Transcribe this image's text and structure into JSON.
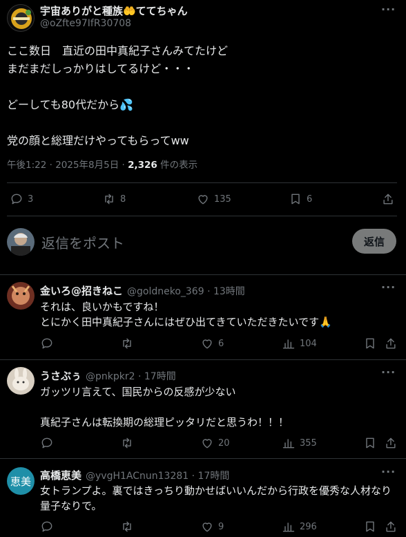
{
  "main_post": {
    "display_name": "宇宙ありがと種族🤲ててちゃん",
    "handle": "@oZfte97IfR30708",
    "lines": [
      "ここ数日　直近の田中真紀子さんみてたけど",
      "まだまだしっかりはしてるけど・・・",
      "",
      "どーしても80代だから💦",
      "",
      "党の顔と総理だけやってもらってww"
    ],
    "timestamp": "午後1:22 · 2025年8月5日 · ",
    "views_count": "2,326",
    "views_label": " 件の表示",
    "stats": {
      "replies": "3",
      "reposts": "8",
      "likes": "135",
      "bookmarks": "6"
    }
  },
  "reply_box": {
    "placeholder": "返信をポスト",
    "button_label": "返信"
  },
  "replies": [
    {
      "display_name": "金いろ@招きねこ",
      "handle": "@goldneko_369 · 13時間",
      "text": "それは、良いかもですね！\nとにかく田中真紀子さんにはぜひ出てきていただきたいです🙏",
      "likes": "6",
      "views": "104",
      "avatar_color": "#b5694a"
    },
    {
      "display_name": "うさぶぅ",
      "handle": "@pnkpkr2 · 17時間",
      "text": "ガッツリ言えて、国民からの反感が少ない\n\n真紀子さんは転換期の総理ピッタリだと思うわ！！！",
      "likes": "20",
      "views": "355",
      "avatar_color": "#c9b9a6"
    },
    {
      "display_name": "高橋恵美",
      "handle": "@yvgH1ACnun13281 · 17時間",
      "text": "女トランプよ。裏ではきっちり動かせばいいんだから行政を優秀な人材なり\n量子なりで。",
      "likes": "9",
      "views": "296",
      "avatar_text": "恵美",
      "avatar_color": "#1f8fa8"
    }
  ],
  "colors": {
    "background": "#000000",
    "text": "#e7e9ea",
    "muted": "#71767b",
    "border": "#2f3336",
    "accent": "#1d9bf0"
  }
}
